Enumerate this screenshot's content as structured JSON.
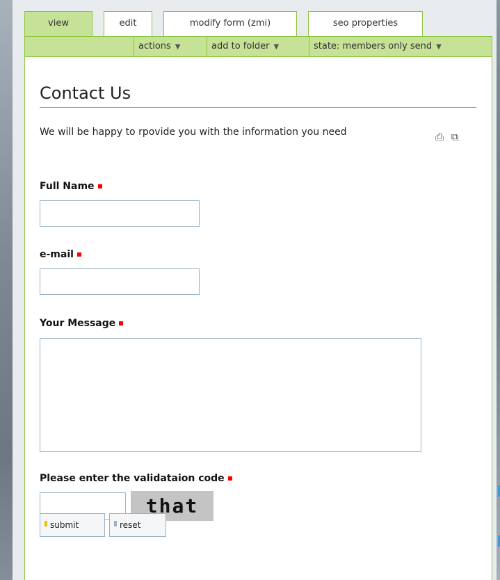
{
  "tabs": [
    {
      "label": "view",
      "active": true
    },
    {
      "label": "edit",
      "active": false
    },
    {
      "label": "modify form (zmi)",
      "active": false
    },
    {
      "label": "seo properties",
      "active": false
    }
  ],
  "actions": {
    "actions_label": "actions",
    "add_to_folder_label": "add to folder",
    "state_label": "state: members only send"
  },
  "page": {
    "title": "Contact Us",
    "description": "We will be happy to rpovide you with the information you need"
  },
  "form": {
    "full_name_label": "Full Name",
    "full_name_value": "",
    "email_label": "e-mail",
    "email_value": "",
    "message_label": "Your Message",
    "message_value": "",
    "validation_label": "Please enter the validataion code",
    "validation_value": "",
    "captcha_text": "that"
  },
  "buttons": {
    "submit_label": "submit",
    "reset_label": "reset"
  },
  "icons": {
    "print": "print-icon",
    "fullscreen": "fullscreen-icon"
  },
  "colors": {
    "tab_border": "#8cc43c",
    "active_tab": "#c5e297",
    "required_marker": "#ff0000"
  }
}
